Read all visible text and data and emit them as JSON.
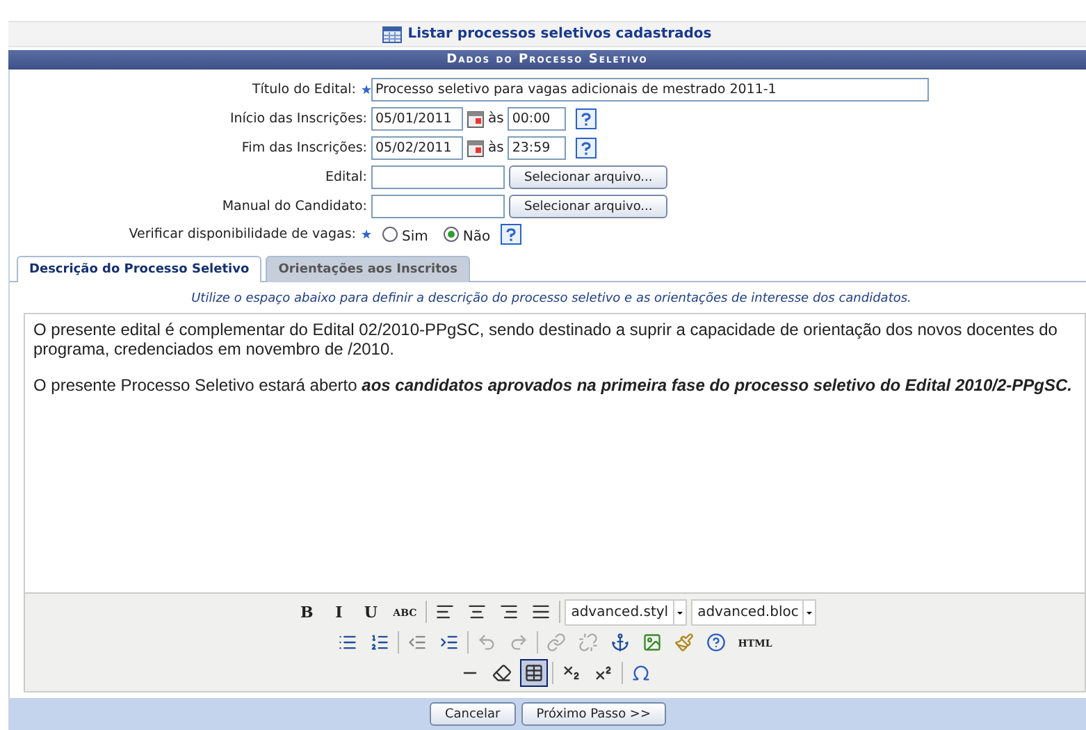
{
  "top_link": {
    "label": "Listar processos seletivos cadastrados"
  },
  "section_title": "Dados do Processo Seletivo",
  "form": {
    "fields": [
      {
        "kind": "text",
        "label": "Título do Edital:",
        "required": true,
        "value": "Processo seletivo para vagas adicionais de mestrado 2011-1"
      },
      {
        "kind": "datetime",
        "label": "Início das Inscrições:",
        "required": false,
        "date": "05/01/2011",
        "at": "às",
        "time": "00:00"
      },
      {
        "kind": "datetime",
        "label": "Fim das Inscrições:",
        "required": false,
        "date": "05/02/2011",
        "at": "às",
        "time": "23:59"
      },
      {
        "kind": "file",
        "label": "Edital:",
        "required": false,
        "button": "Selecionar arquivo..."
      },
      {
        "kind": "file",
        "label": "Manual do Candidato:",
        "required": false,
        "button": "Selecionar arquivo..."
      },
      {
        "kind": "radio",
        "label": "Verificar disponibilidade de vagas:",
        "required": true,
        "options": [
          {
            "label": "Sim",
            "selected": false
          },
          {
            "label": "Não",
            "selected": true
          }
        ]
      }
    ]
  },
  "tabs": [
    {
      "label": "Descrição do Processo Seletivo",
      "selected": true
    },
    {
      "label": "Orientações aos Inscritos",
      "selected": false
    }
  ],
  "hint": "Utilize o espaço abaixo para definir a descrição do processo seletivo e as orientações de interesse dos candidatos.",
  "editor": {
    "paragraphs": [
      "O presente edital é complementar do Edital 02/2010-PPgSC, sendo destinado a suprir a capacidade de orientação dos novos docentes do programa, credenciados em novembro de /2010.",
      "O presente Processo Seletivo estará aberto **aos candidatos aprovados na primeira fase do processo seletivo do Edital 2010/2-PPgSC.**"
    ],
    "toolbar": [
      [
        {
          "kind": "glyph",
          "label": "B",
          "active": false
        },
        {
          "kind": "glyph",
          "label": "I",
          "active": false
        },
        {
          "kind": "glyph",
          "label": "U",
          "active": false
        },
        {
          "kind": "glyph",
          "label": "ABC",
          "active": false
        },
        {
          "kind": "sep"
        },
        {
          "kind": "align-left",
          "active": false
        },
        {
          "kind": "align-center",
          "active": false
        },
        {
          "kind": "align-right",
          "active": false
        },
        {
          "kind": "align-justify",
          "active": false
        },
        {
          "kind": "sep"
        },
        {
          "kind": "select",
          "value": "advanced.styl"
        },
        {
          "kind": "select",
          "value": "advanced.bloc"
        }
      ],
      [
        {
          "kind": "bullets",
          "active": false
        },
        {
          "kind": "numbers",
          "active": false
        },
        {
          "kind": "sep"
        },
        {
          "kind": "outdent",
          "active": false
        },
        {
          "kind": "indent",
          "active": false
        },
        {
          "kind": "sep"
        },
        {
          "kind": "undo",
          "active": false
        },
        {
          "kind": "redo",
          "active": false
        },
        {
          "kind": "sep"
        },
        {
          "kind": "link",
          "active": false
        },
        {
          "kind": "unlink",
          "active": false
        },
        {
          "kind": "anchor",
          "active": false
        },
        {
          "kind": "image",
          "active": false
        },
        {
          "kind": "brush",
          "active": false
        },
        {
          "kind": "help",
          "active": false
        },
        {
          "kind": "glyph",
          "label": "HTML",
          "active": false
        }
      ],
      [
        {
          "kind": "rule",
          "active": false
        },
        {
          "kind": "eraser",
          "active": false
        },
        {
          "kind": "table",
          "active": true
        },
        {
          "kind": "sep"
        },
        {
          "kind": "subscript",
          "active": false
        },
        {
          "kind": "superscript",
          "active": false
        },
        {
          "kind": "sep"
        },
        {
          "kind": "omega",
          "active": false
        }
      ]
    ]
  },
  "buttons": [
    "Cancelar",
    "Próximo Passo >>"
  ]
}
